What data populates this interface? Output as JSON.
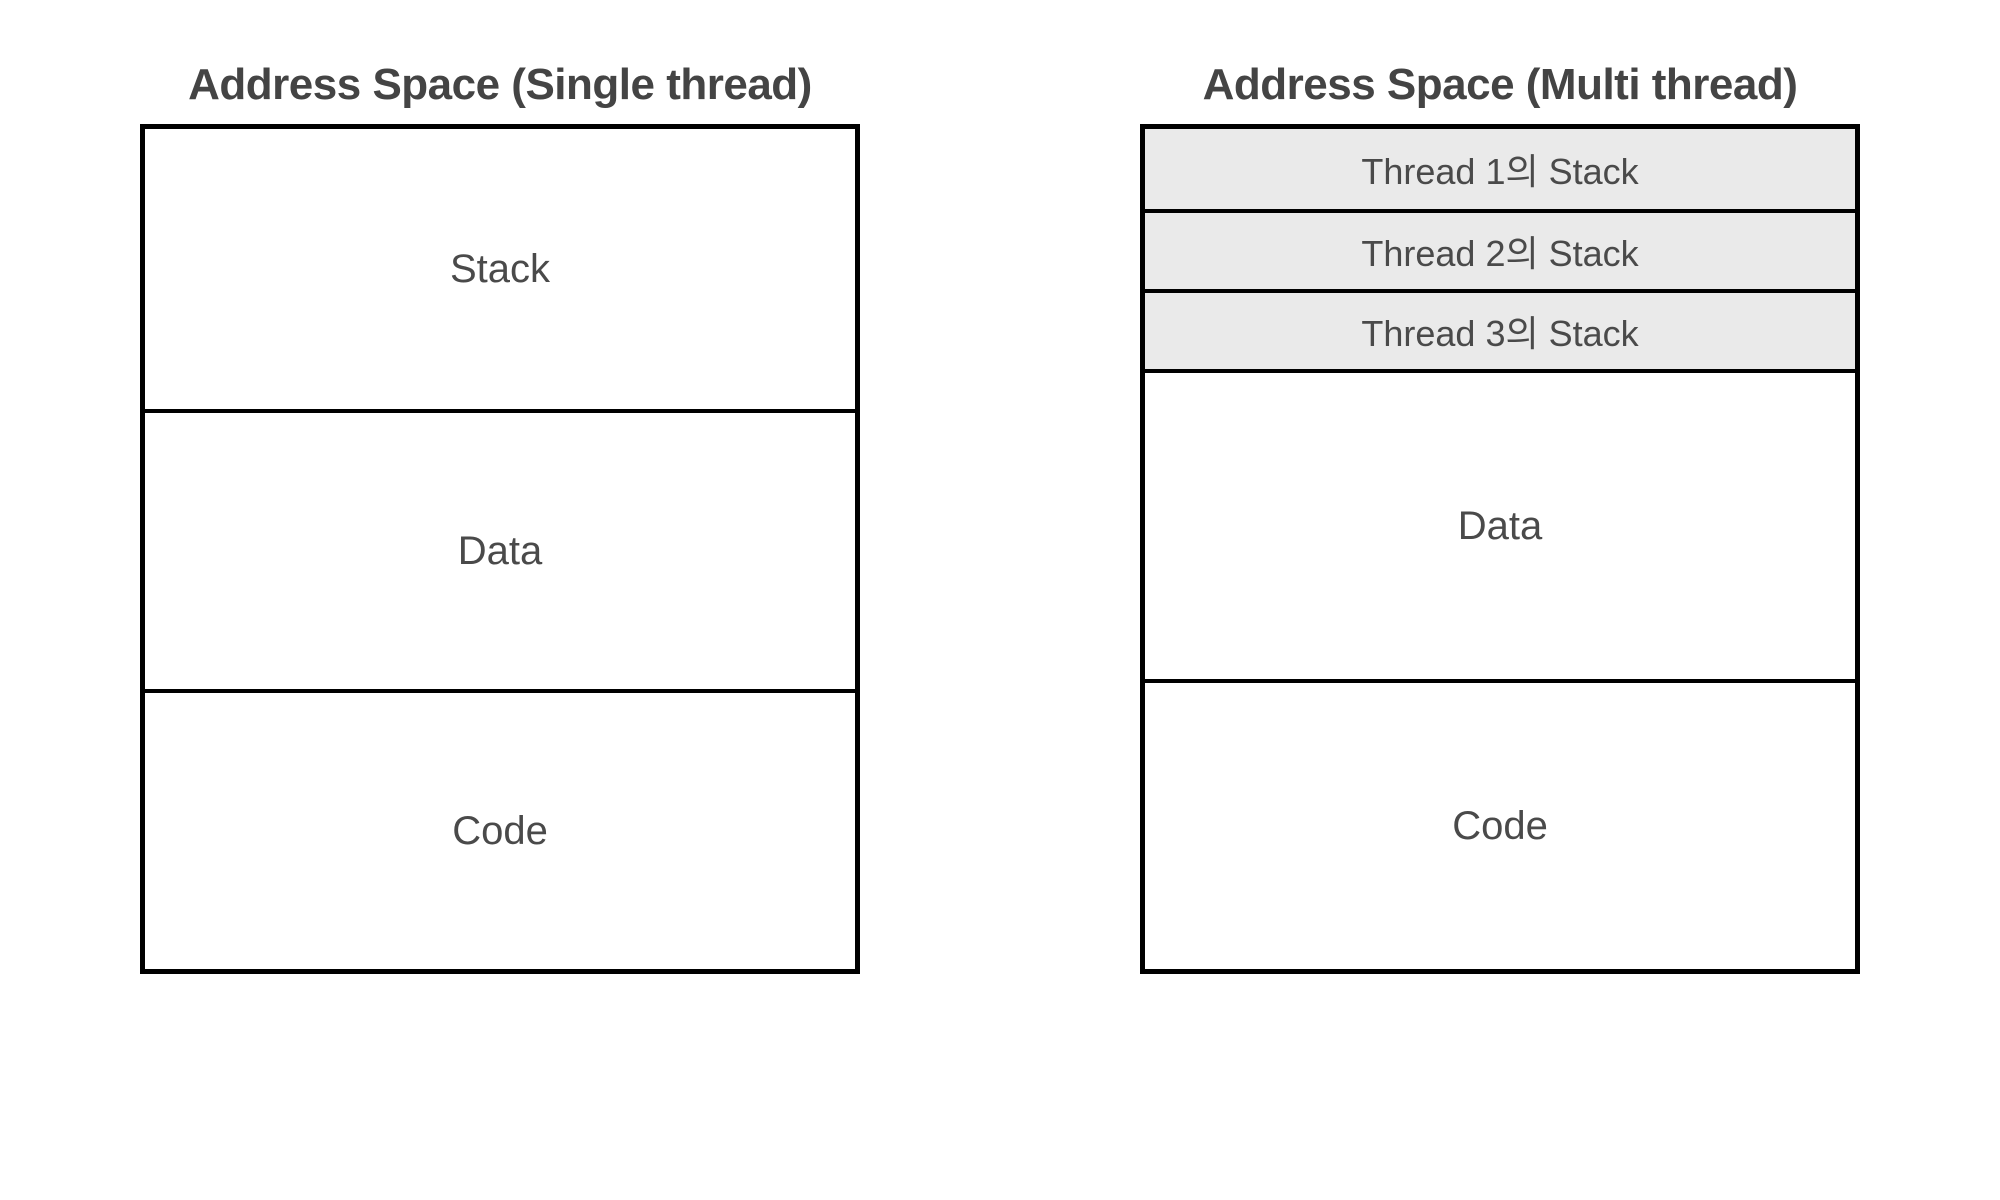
{
  "left": {
    "title": "Address Space (Single thread)",
    "segments": {
      "stack": "Stack",
      "data": "Data",
      "code": "Code"
    }
  },
  "right": {
    "title": "Address Space (Multi thread)",
    "threads": [
      "Thread 1의 Stack",
      "Thread 2의 Stack",
      "Thread 3의 Stack"
    ],
    "segments": {
      "data": "Data",
      "code": "Code"
    }
  }
}
